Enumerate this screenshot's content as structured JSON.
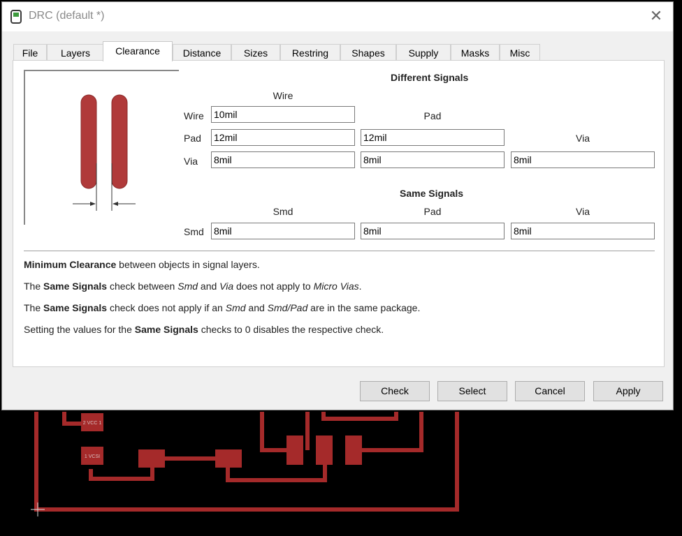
{
  "window": {
    "title": "DRC (default *)"
  },
  "tabs": [
    "File",
    "Layers",
    "Clearance",
    "Distance",
    "Sizes",
    "Restring",
    "Shapes",
    "Supply",
    "Masks",
    "Misc"
  ],
  "active_tab": "Clearance",
  "different_signals": {
    "heading": "Different Signals",
    "col_wire": "Wire",
    "col_pad": "Pad",
    "col_via": "Via",
    "row_wire": "Wire",
    "row_pad": "Pad",
    "row_via": "Via",
    "wire_wire": "10mil",
    "pad_wire": "12mil",
    "pad_pad": "12mil",
    "via_wire": "8mil",
    "via_pad": "8mil",
    "via_via": "8mil"
  },
  "same_signals": {
    "heading": "Same Signals",
    "col_smd": "Smd",
    "col_pad": "Pad",
    "col_via": "Via",
    "row_smd": "Smd",
    "smd_smd": "8mil",
    "smd_pad": "8mil",
    "smd_via": "8mil"
  },
  "info": {
    "line1_bold": "Minimum Clearance",
    "line1_rest": " between objects in signal layers.",
    "line2_a": "The ",
    "line2_bold": "Same Signals",
    "line2_b": " check between ",
    "line2_i1": "Smd",
    "line2_c": " and ",
    "line2_i2": "Via",
    "line2_d": " does not apply to ",
    "line2_i3": "Micro Vias",
    "line2_e": ".",
    "line3_a": "The ",
    "line3_bold": "Same Signals",
    "line3_b": " check does not apply if an ",
    "line3_i1": "Smd",
    "line3_c": " and ",
    "line3_i2": "Smd/Pad",
    "line3_d": " are in the same package.",
    "line4_a": "Setting the values for the ",
    "line4_bold": "Same Signals",
    "line4_b": " checks to 0 disables the respective check."
  },
  "buttons": {
    "check": "Check",
    "select": "Select",
    "cancel": "Cancel",
    "apply": "Apply"
  },
  "board": {
    "pad1_label": "2 VCC 1",
    "pad2_label": "1 VCSI"
  },
  "colors": {
    "trace": "#a52a2a",
    "pad": "#b22222",
    "preview_trace": "#b03a3a"
  }
}
